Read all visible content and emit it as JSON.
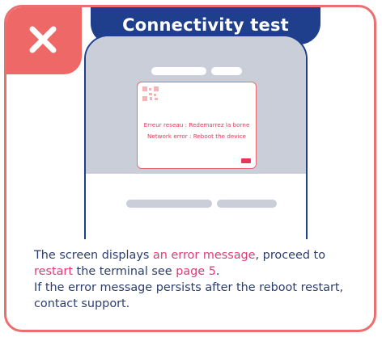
{
  "header": {
    "title": "Connectivity test",
    "close_icon": "close-x-icon"
  },
  "device_screen": {
    "error_fr": "Erreur reseau : Redemarrez la borne",
    "error_en": "Network error : Reboot the device"
  },
  "message": {
    "p1": "The screen displays ",
    "hl1": "an error message",
    "p2": ", proceed to ",
    "hl2": "restart",
    "p3": " the terminal see ",
    "hl3": "page 5",
    "p4": ".",
    "line2": "If the error message persists after the reboot restart, contact support."
  },
  "colors": {
    "accent_red": "#ef6868",
    "brand_blue": "#1f3f8c",
    "highlight_pink": "#e23a78",
    "text": "#2d3e6e"
  }
}
